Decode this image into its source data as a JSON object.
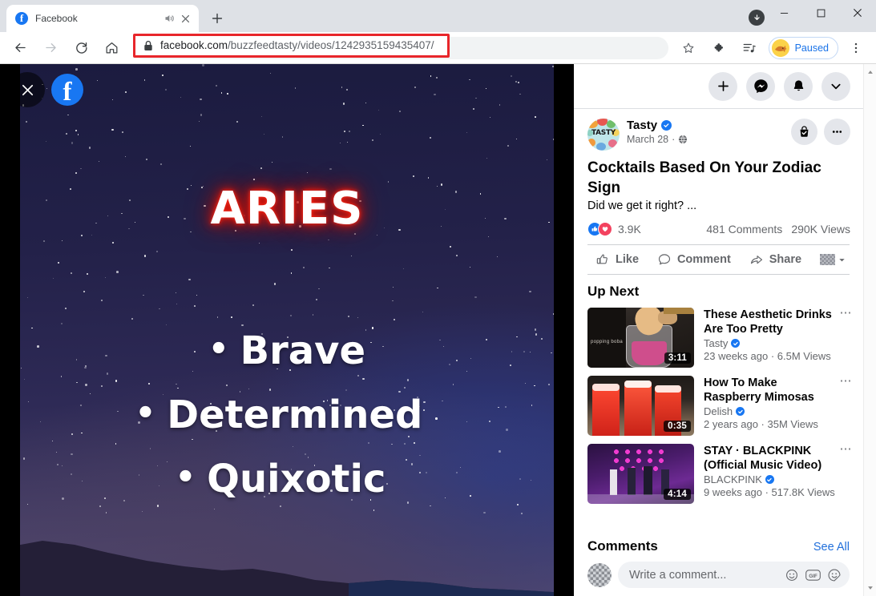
{
  "browser": {
    "tab": {
      "title": "Facebook",
      "favicon": "facebook-favicon",
      "audio_icon": "speaker-icon",
      "close_icon": "close-icon"
    },
    "new_tab_label": "+",
    "window_controls": {
      "minimize": "–",
      "maximize": "□",
      "close": "✕",
      "download": "download-icon"
    },
    "nav": {
      "back": "back-arrow-icon",
      "forward": "forward-arrow-icon",
      "reload": "reload-icon",
      "home": "home-icon"
    },
    "omnibox": {
      "lock_icon": "lock-icon",
      "url_domain": "facebook.com",
      "url_path": "/buzzfeedtasty/videos/1242935159435407/",
      "highlight_color": "#e8262b"
    },
    "toolbar_right": {
      "bookmark_icon": "star-icon",
      "extensions_icon": "puzzle-piece-icon",
      "reading_list_icon": "media-list-icon",
      "profile_label": "Paused",
      "profile_avatar": "dog-avatar-icon",
      "menu_icon": "three-dot-menu-icon"
    }
  },
  "video": {
    "close_label": "✕",
    "logo": "f",
    "title": "ARIES",
    "title_glow_color": "#e7170a",
    "traits": [
      "Brave",
      "Determined",
      "Quixotic"
    ],
    "bullet": "•"
  },
  "sidebar": {
    "header_buttons": [
      {
        "name": "create-button",
        "icon": "plus-icon"
      },
      {
        "name": "messenger-button",
        "icon": "messenger-icon"
      },
      {
        "name": "notifications-button",
        "icon": "bell-icon"
      },
      {
        "name": "account-menu-button",
        "icon": "chevron-down-icon"
      }
    ],
    "post": {
      "page_name": "Tasty",
      "avatar_text": "TASTY",
      "verified": true,
      "date": "March 28",
      "date_separator": "·",
      "privacy_icon": "globe-icon",
      "save_icon": "saved-bag-icon",
      "more_icon": "three-dot-menu-icon",
      "title": "Cocktails Based On Your Zodiac Sign",
      "description": "Did we get it right? ...",
      "reactions": {
        "icons": [
          "like-icon",
          "heart-icon"
        ],
        "count": "3.9K"
      },
      "comments_count": "481 Comments",
      "views_count": "290K Views",
      "actions": [
        {
          "name": "like-button",
          "label": "Like",
          "icon": "thumbs-up-icon"
        },
        {
          "name": "comment-button",
          "label": "Comment",
          "icon": "speech-bubble-icon"
        },
        {
          "name": "share-button",
          "label": "Share",
          "icon": "share-arrow-icon"
        }
      ],
      "share_as_avatar": "pixelated-avatar-icon",
      "share_as_caret": "chevron-down-icon"
    },
    "up_next": {
      "heading": "Up Next",
      "items": [
        {
          "title": "These Aesthetic Drinks Are Too Pretty",
          "channel": "Tasty",
          "verified": true,
          "meta": "23 weeks ago · 6.5M Views",
          "duration": "3:11",
          "thumb_label": "popping boba",
          "more_icon": "three-dot-menu-icon"
        },
        {
          "title": "How To Make Raspberry Mimosas",
          "channel": "Delish",
          "verified": true,
          "meta": "2 years ago · 35M Views",
          "duration": "0:35",
          "more_icon": "three-dot-menu-icon"
        },
        {
          "title": "STAY · BLACKPINK (Official Music Video)",
          "channel": "BLACKPINK",
          "verified": true,
          "meta": "9 weeks ago · 517.8K Views",
          "duration": "4:14",
          "more_icon": "three-dot-menu-icon"
        }
      ]
    },
    "comments": {
      "heading": "Comments",
      "see_all": "See All",
      "avatar": "pixelated-avatar-icon",
      "placeholder": "Write a comment...",
      "icons": [
        "emoji-icon",
        "gif-icon",
        "sticker-icon"
      ],
      "gif_label": "GIF"
    },
    "scrollbar": {
      "up": "scroll-up-arrow-icon",
      "down": "scroll-down-arrow-icon"
    }
  },
  "colors": {
    "facebook_blue": "#1877f2",
    "link_blue": "#216fdb",
    "chrome_tabstrip": "#dee1e6",
    "reaction_red": "#f3425f"
  }
}
